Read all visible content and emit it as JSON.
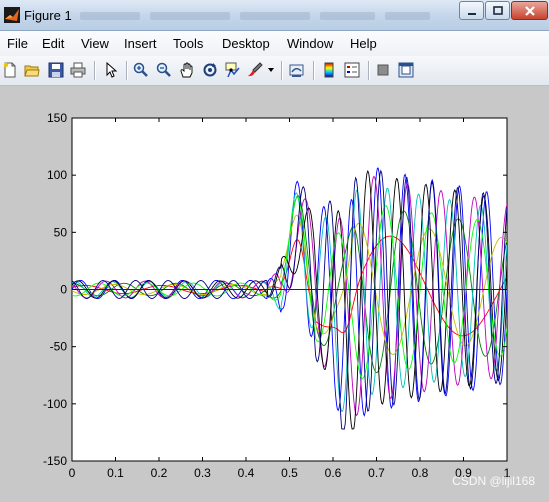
{
  "window": {
    "title": "Figure 1"
  },
  "menu": [
    "File",
    "Edit",
    "View",
    "Insert",
    "Tools",
    "Desktop",
    "Window",
    "Help"
  ],
  "toolbar": [
    "new-figure",
    "open-file",
    "save",
    "print",
    "edit-plot",
    "zoom-in",
    "zoom-out",
    "pan",
    "rotate-3d",
    "data-cursor",
    "brush",
    "link-plot",
    "hide-plot-tools",
    "insert-colorbar",
    "insert-legend",
    "hide-plot-tools-2",
    "show-plot-tools"
  ],
  "watermark": "CSDN @lijil168",
  "chart_data": {
    "type": "line",
    "xlim": [
      0,
      1
    ],
    "ylim": [
      -150,
      150
    ],
    "xticks": [
      "0",
      "0.1",
      "0.2",
      "0.3",
      "0.4",
      "0.5",
      "0.6",
      "0.7",
      "0.8",
      "0.9",
      "1"
    ],
    "yticks": [
      "150",
      "100",
      "50",
      "0",
      "-50",
      "-100",
      "-150"
    ],
    "grid": false,
    "series_colors": [
      "#0000ff",
      "#008000",
      "#ff0000",
      "#00bfbf",
      "#bf00bf",
      "#bfbf00",
      "#000000",
      "#00ff00",
      "#000080",
      "#800000"
    ],
    "notes": "Ten overlapping oscillating signal traces; small amplitude (about ±10) before x≈0.45, peaking near 60 at x≈0.52, large oscillations from about -120 to 110 over x≈0.55–1."
  }
}
